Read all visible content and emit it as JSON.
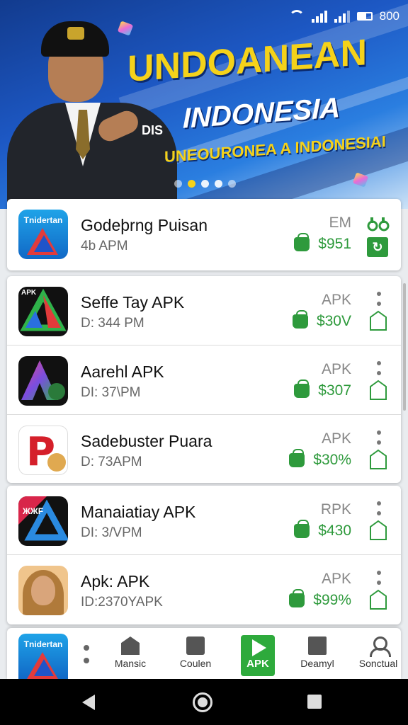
{
  "status_bar": {
    "time": "800"
  },
  "banner": {
    "headline": "UNDOANEAN",
    "subheadline": "INDONESIA",
    "prefix": "DIS",
    "tagline": "UNEOURONEA A INDONESIAI",
    "slide_count": 5,
    "active_slide": 1
  },
  "featured": {
    "icon_label": "Tnidertan",
    "title": "Godeþrng Puisan",
    "subtitle": "4b APM",
    "type": "EM",
    "price": "$951"
  },
  "apps": [
    {
      "title": "Seffe Tay APK",
      "subtitle": "D: 344 PM",
      "type": "APK",
      "price": "$30V",
      "icon": "apk-triangle-icon",
      "icon_label": "APK"
    },
    {
      "title": "Aarehl APK",
      "subtitle": "DI: 37\\PM",
      "type": "APK",
      "price": "$307",
      "icon": "gradient-a-icon"
    },
    {
      "title": "Sadebuster Puara",
      "subtitle": "D: 73APM",
      "type": "APK",
      "price": "$30%",
      "icon": "p-letter-icon"
    },
    {
      "title": "Manaiatiay APK",
      "subtitle": "DI: 3/VPM",
      "type": "RPK",
      "price": "$430",
      "icon": "triangle-dark-icon",
      "icon_label": "ЖЖF"
    },
    {
      "title": "Apk: APK",
      "subtitle": "ID:2370YAPK",
      "type": "APK",
      "price": "$99%",
      "icon": "woman-portrait-icon"
    }
  ],
  "bottom_nav": {
    "app_icon_label": "Tnidertan",
    "items": [
      {
        "label": "Mansic",
        "icon": "house-icon"
      },
      {
        "label": "Coulen",
        "icon": "tray-icon"
      },
      {
        "label": "APK",
        "icon": "play-icon"
      },
      {
        "label": "Deamyl",
        "icon": "photo-icon"
      },
      {
        "label": "Sonctual",
        "icon": "person-icon"
      }
    ]
  },
  "colors": {
    "accent_green": "#2e9a3c",
    "banner_blue": "#1d58c4",
    "headline_yellow": "#f5d21a"
  }
}
